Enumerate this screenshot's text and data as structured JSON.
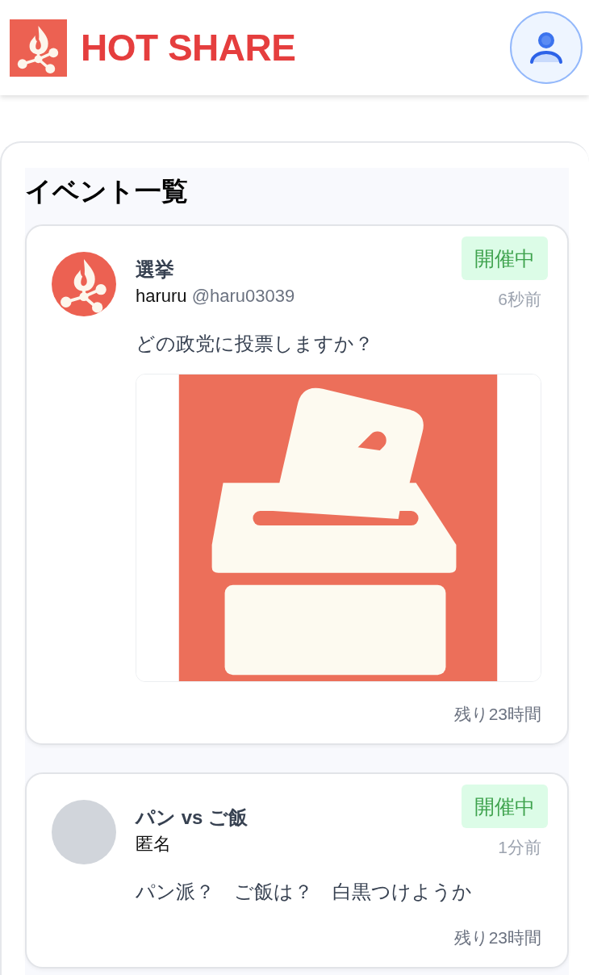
{
  "header": {
    "brand": "HOT SHARE"
  },
  "section": {
    "title": "イベント一覧"
  },
  "posts": [
    {
      "title": "選挙",
      "author": "haruru",
      "handle": "@haru03039",
      "avatar": {
        "kind": "logo"
      },
      "status": "開催中",
      "time": "6秒前",
      "body": "どの政党に投票しますか？",
      "remaining": "残り23時間"
    },
    {
      "title": "パン vs ご飯",
      "author": "匿名",
      "avatar": {
        "kind": "placeholder"
      },
      "status": "開催中",
      "time": "1分前",
      "body": "パン派？　ご飯は？　白黒つけようか",
      "remaining": "残り23時間"
    }
  ]
}
